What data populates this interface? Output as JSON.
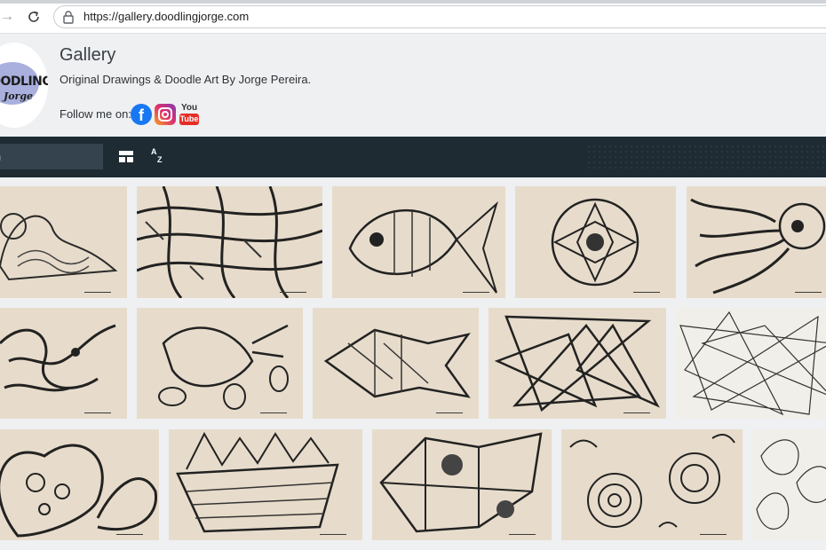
{
  "browser": {
    "url": "https://gallery.doodlingjorge.com",
    "forward_icon": "arrow-right-icon",
    "reload_icon": "reload-icon",
    "lock_icon": "lock-icon"
  },
  "header": {
    "logo_line1": "DOODLING",
    "logo_line2": "Jorge",
    "title": "Gallery",
    "subtitle": "Original Drawings & Doodle Art By Jorge Pereira.",
    "follow_label": "Follow me on:",
    "social": [
      {
        "name": "facebook",
        "glyph": "f"
      },
      {
        "name": "instagram"
      },
      {
        "name": "youtube",
        "you": "You",
        "tube": "Tube"
      }
    ]
  },
  "toolbar": {
    "search_placeholder": "h",
    "layout_icon": "layout-icon",
    "sort_icon": "sort-az-icon",
    "sort_top": "A",
    "sort_bottom": "Z"
  },
  "gallery": {
    "rows": 3,
    "items": [
      {
        "subject": "duck doodle"
      },
      {
        "subject": "woven pattern doodle"
      },
      {
        "subject": "fish doodle"
      },
      {
        "subject": "flower doodle"
      },
      {
        "subject": "octopus doodle"
      },
      {
        "subject": "octopus tentacles doodle"
      },
      {
        "subject": "bird doodle"
      },
      {
        "subject": "geometric fish doodle"
      },
      {
        "subject": "triangles doodle"
      },
      {
        "subject": "line triangles doodle"
      },
      {
        "subject": "heart doodle"
      },
      {
        "subject": "boat doodle"
      },
      {
        "subject": "pattern cluster doodle"
      },
      {
        "subject": "spiral shells doodle"
      },
      {
        "subject": "leaves doodle"
      }
    ]
  },
  "colors": {
    "toolbar_bg": "#1e2b33",
    "search_bg": "#34434d",
    "page_bg": "#eef0f2",
    "paper": "#e7dccb"
  }
}
